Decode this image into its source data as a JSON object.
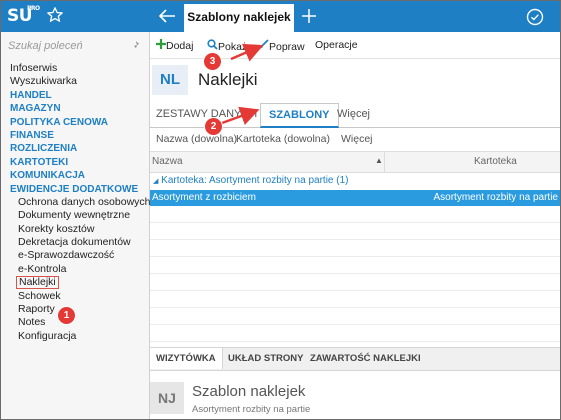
{
  "app": {
    "logo": "SU",
    "logo_sup": "PRO"
  },
  "topbar": {
    "active_tab": "Szablony naklejek"
  },
  "sidebar": {
    "search_placeholder": "Szukaj poleceń",
    "items": [
      {
        "label": "Infoserwis",
        "kind": "top"
      },
      {
        "label": "Wyszukiwarka",
        "kind": "top"
      },
      {
        "label": "HANDEL",
        "kind": "sec"
      },
      {
        "label": "MAGAZYN",
        "kind": "sec"
      },
      {
        "label": "POLITYKA CENOWA",
        "kind": "sec"
      },
      {
        "label": "FINANSE",
        "kind": "sec"
      },
      {
        "label": "ROZLICZENIA",
        "kind": "sec"
      },
      {
        "label": "KARTOTEKI",
        "kind": "sec"
      },
      {
        "label": "KOMUNIKACJA",
        "kind": "sec"
      },
      {
        "label": "EWIDENCJE DODATKOWE",
        "kind": "sec"
      },
      {
        "label": "Ochrona danych osobowych",
        "kind": "sub"
      },
      {
        "label": "Dokumenty wewnętrzne",
        "kind": "sub"
      },
      {
        "label": "Korekty kosztów",
        "kind": "sub"
      },
      {
        "label": "Dekretacja dokumentów",
        "kind": "sub"
      },
      {
        "label": "e-Sprawozdawczość",
        "kind": "sub"
      },
      {
        "label": "e-Kontrola",
        "kind": "sub"
      },
      {
        "label": "Naklejki",
        "kind": "hl"
      },
      {
        "label": "Schowek",
        "kind": "sub"
      },
      {
        "label": "Raporty",
        "kind": "sub"
      },
      {
        "label": "Notes",
        "kind": "sub"
      },
      {
        "label": "Konfiguracja",
        "kind": "sub"
      }
    ]
  },
  "toolbar": {
    "add": "Dodaj",
    "show": "Pokaż",
    "edit": "Popraw",
    "ops": "Operacje"
  },
  "page": {
    "badge": "NL",
    "title": "Naklejki"
  },
  "tabs": {
    "sets": "ZESTAWY DANYCH",
    "templates": "SZABLONY",
    "more": "Więcej"
  },
  "filters": {
    "name": "Nazwa (dowolna)",
    "card": "Kartoteka (dowolna)",
    "more": "Więcej"
  },
  "grid": {
    "col_name": "Nazwa",
    "col_card": "Kartoteka",
    "group_label": "Kartoteka: Asortyment rozbity na partie (1)",
    "rows": [
      {
        "name": "Asortyment z rozbiciem",
        "card": "Asortyment rozbity na partie"
      }
    ]
  },
  "bottom_tabs": {
    "card": "WIZYTÓWKA",
    "layout": "UKŁAD STRONY",
    "content": "ZAWARTOŚĆ NAKLEJKI"
  },
  "detail": {
    "badge": "NJ",
    "title": "Szablon naklejek",
    "subtitle": "Asortyment rozbity na partie"
  },
  "callouts": {
    "one": "1",
    "two": "2",
    "three": "3"
  },
  "colors": {
    "accent": "#1e7fc4",
    "selection": "#2b9be0",
    "callout": "#e53935"
  }
}
